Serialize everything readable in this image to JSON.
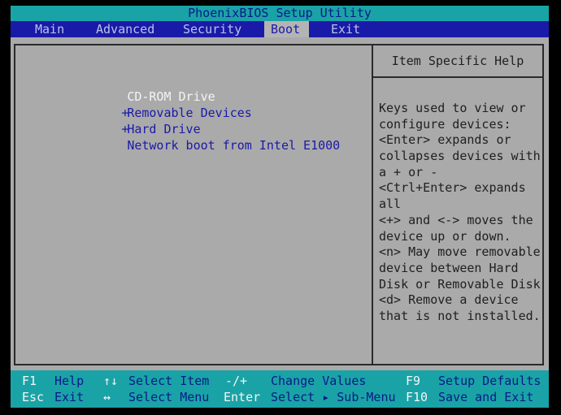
{
  "title": "PhoenixBIOS Setup Utility",
  "menu": [
    {
      "label": "Main"
    },
    {
      "label": "Advanced"
    },
    {
      "label": "Security"
    },
    {
      "label": "Boot"
    },
    {
      "label": "Exit"
    }
  ],
  "active_menu": "Boot",
  "boot_list": [
    {
      "prefix": "",
      "label": "CD-ROM Drive",
      "selected": true
    },
    {
      "prefix": "+",
      "label": "Removable Devices",
      "selected": false
    },
    {
      "prefix": "+",
      "label": "Hard Drive",
      "selected": false
    },
    {
      "prefix": "",
      "label": "Network boot from Intel E1000",
      "selected": false
    }
  ],
  "help": {
    "title": "Item Specific Help",
    "lines": [
      "Keys used to view or",
      "configure devices:",
      "<Enter> expands or",
      "collapses devices with",
      "a + or -",
      "<Ctrl+Enter> expands",
      "all",
      "<+> and <-> moves the",
      "device up or down.",
      "<n> May move removable",
      "device between Hard",
      "Disk or Removable Disk",
      "<d> Remove a device",
      "that is not installed."
    ]
  },
  "footer": {
    "row1": [
      {
        "key": "F1",
        "desc": "Help"
      },
      {
        "key": "↑↓",
        "desc": "Select Item"
      },
      {
        "key": "-/+",
        "desc": "Change Values"
      },
      {
        "key": "F9",
        "desc": "Setup Defaults"
      }
    ],
    "row2": [
      {
        "key": "Esc",
        "desc": "Exit"
      },
      {
        "key": "↔",
        "desc": "Select Menu"
      },
      {
        "key": "Enter",
        "desc": "Select ▸ Sub-Menu"
      },
      {
        "key": "F10",
        "desc": "Save and Exit"
      }
    ]
  },
  "colors": {
    "cyan_bar": "#1aa3a6",
    "menu_bar": "#1a1aa8",
    "body_gray": "#aaaaaa",
    "selected_text": "#f4f4f4"
  }
}
